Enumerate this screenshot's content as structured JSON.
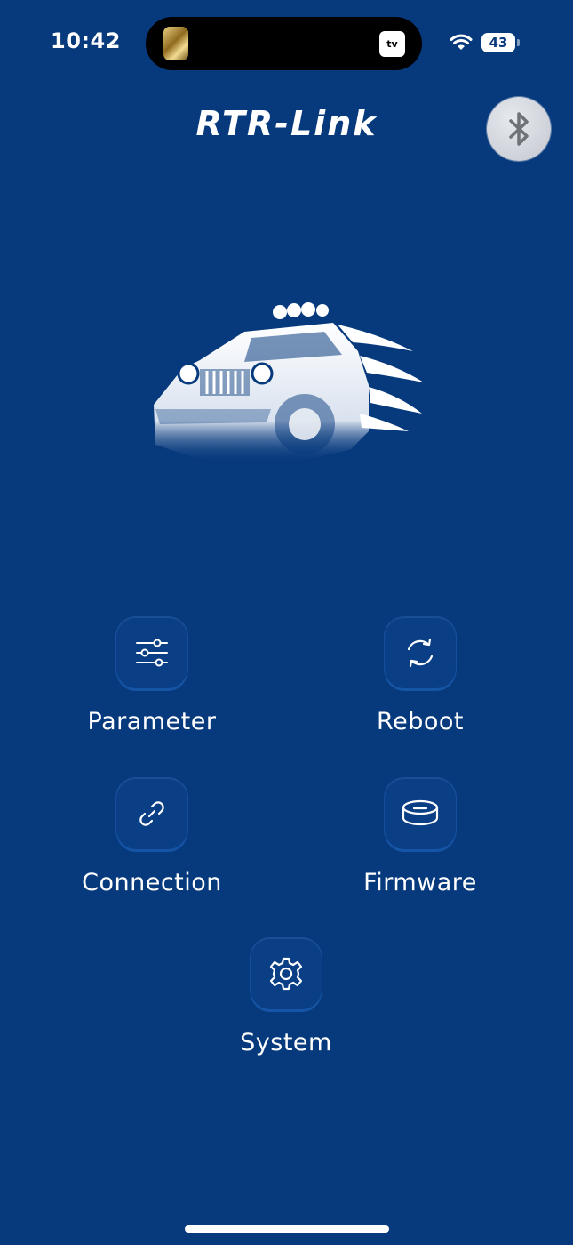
{
  "status_bar": {
    "time": "10:42",
    "island_app_icon": "gold-app-icon",
    "island_tv_label": "tv",
    "battery_level": "43"
  },
  "header": {
    "title": "RTR-Link",
    "bluetooth_icon": "bluetooth-icon"
  },
  "hero_image": "offroad-truck-illustration",
  "menu": {
    "parameter": {
      "label": "Parameter",
      "icon": "sliders-icon"
    },
    "reboot": {
      "label": "Reboot",
      "icon": "refresh-icon"
    },
    "connection": {
      "label": "Connection",
      "icon": "link-icon"
    },
    "firmware": {
      "label": "Firmware",
      "icon": "chip-icon"
    },
    "system": {
      "label": "System",
      "icon": "gear-icon"
    }
  },
  "colors": {
    "background": "#073a7d",
    "tile": "#0a3f86",
    "text": "#ffffff"
  }
}
